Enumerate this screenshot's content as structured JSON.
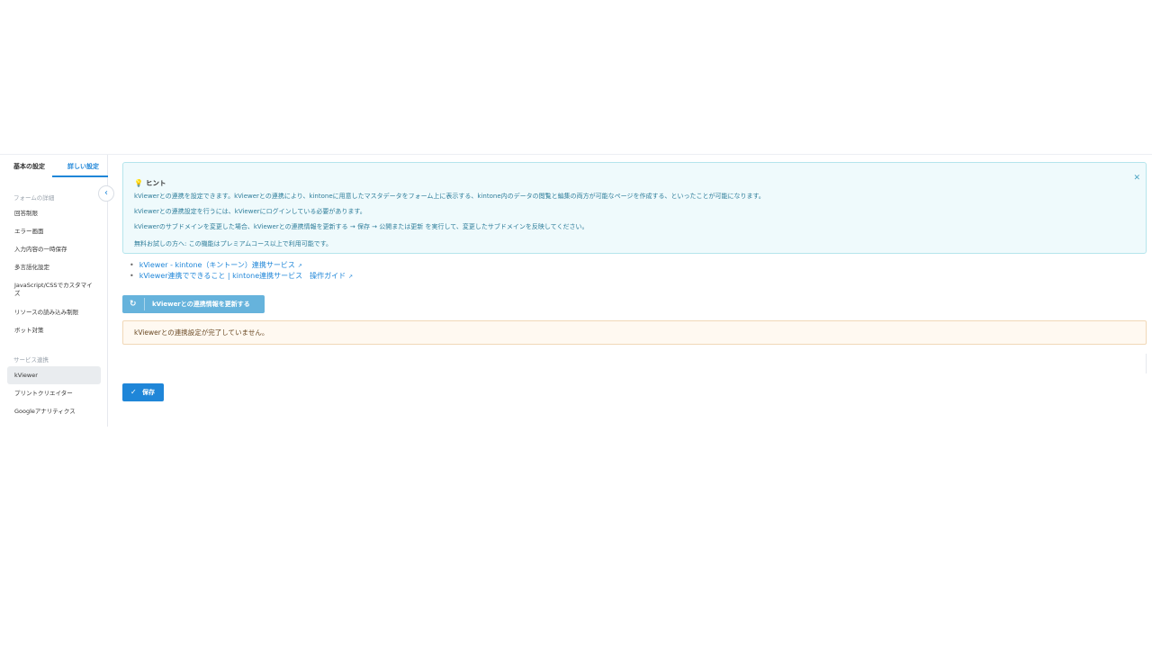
{
  "tabs": {
    "basic": "基本の設定",
    "detail": "詳しい設定"
  },
  "sidebar": {
    "collapse_icon": "‹",
    "section_form": "フォームの詳細",
    "form_items": [
      "回答制限",
      "エラー画面",
      "入力内容の一時保存",
      "多言語化設定",
      "JavaScript/CSSでカスタマイズ",
      "リソースの読み込み制限",
      "ボット対策"
    ],
    "section_service": "サービス連携",
    "service_items": [
      "kViewer",
      "プリントクリエイター",
      "Googleアナリティクス"
    ],
    "active_item": "kViewer"
  },
  "hint": {
    "title": "ヒント",
    "icon": "lightbulb-icon",
    "close_icon": "close-icon",
    "lines": [
      "kViewerとの連携を設定できます。kViewerとの連携により、kintoneに用意したマスタデータをフォーム上に表示する、kintone内のデータの閲覧と編集の両方が可能なページを作成する、といったことが可能になります。",
      "kViewerとの連携設定を行うには、kViewerにログインしている必要があります。",
      "kViewerのサブドメインを変更した場合、kViewerとの連携情報を更新する → 保存 → 公開または更新 を実行して、変更したサブドメインを反映してください。",
      "無料お試しの方へ: この機能はプレミアムコース以上で利用可能です。"
    ]
  },
  "links": [
    "kViewer - kintone（キントーン）連携サービス",
    "kViewer連携でできること | kintone連携サービス　操作ガイド"
  ],
  "refresh_button": {
    "label": "kViewerとの連携情報を更新する",
    "icon": "refresh-icon"
  },
  "warning": "kViewerとの連携設定が完了していません。",
  "save_button": {
    "label": "保存",
    "icon": "check-icon"
  },
  "colors": {
    "accent": "#1f86d8",
    "hint_bg": "#effafc",
    "warn_bg": "#fff9f1"
  }
}
